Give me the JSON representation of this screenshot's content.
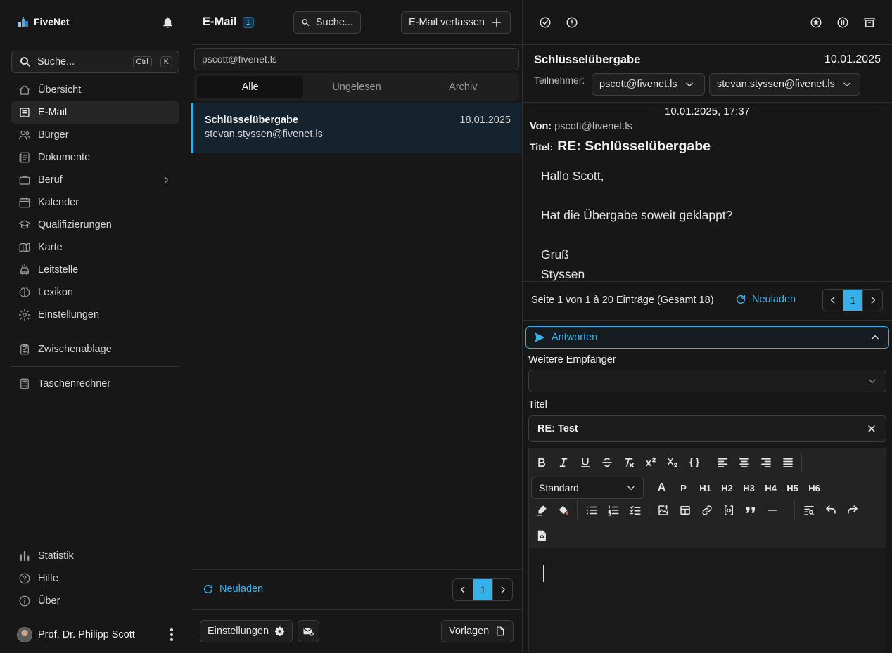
{
  "sidebar": {
    "brand": "FiveNet",
    "search_placeholder": "Suche...",
    "shortcut_ctrl": "Ctrl",
    "shortcut_key": "K",
    "items": [
      {
        "label": "Übersicht",
        "icon": "home-icon"
      },
      {
        "label": "E-Mail",
        "icon": "mail-icon"
      },
      {
        "label": "Bürger",
        "icon": "users-icon"
      },
      {
        "label": "Dokumente",
        "icon": "documents-icon"
      },
      {
        "label": "Beruf",
        "icon": "briefcase-icon"
      },
      {
        "label": "Kalender",
        "icon": "calendar-icon"
      },
      {
        "label": "Qualifizierungen",
        "icon": "graduation-cap-icon"
      },
      {
        "label": "Karte",
        "icon": "map-icon"
      },
      {
        "label": "Leitstelle",
        "icon": "car-siren-icon"
      },
      {
        "label": "Lexikon",
        "icon": "brain-icon"
      },
      {
        "label": "Einstellungen",
        "icon": "gear-icon"
      }
    ],
    "clipboard": "Zwischenablage",
    "calculator": "Taschenrechner",
    "bottom_items": [
      {
        "label": "Statistik",
        "icon": "bar-chart-icon"
      },
      {
        "label": "Hilfe",
        "icon": "help-icon"
      },
      {
        "label": "Über",
        "icon": "info-icon"
      }
    ],
    "user_name": "Prof. Dr. Philipp Scott"
  },
  "list": {
    "title": "E-Mail",
    "count": "1",
    "search_label": "Suche...",
    "compose_label": "E-Mail verfassen",
    "account": "pscott@fivenet.ls",
    "tabs": [
      "Alle",
      "Ungelesen",
      "Archiv"
    ],
    "active_tab": "Alle",
    "threads": [
      {
        "subject": "Schlüsselübergabe",
        "date": "18.01.2025",
        "from": "stevan.styssen@fivenet.ls"
      }
    ],
    "reload_label": "Neuladen",
    "page": "1",
    "settings_label": "Einstellungen",
    "templates_label": "Vorlagen"
  },
  "detail": {
    "subject": "Schlüsselübergabe",
    "date": "10.01.2025",
    "participants_label": "Teilnehmer:",
    "participants": [
      "pscott@fivenet.ls",
      "stevan.styssen@fivenet.ls"
    ],
    "message": {
      "datetime": "10.01.2025, 17:37",
      "from_label": "Von:",
      "from": "pscott@fivenet.ls",
      "title_label": "Titel:",
      "title": "RE: Schlüsselübergabe",
      "lines": [
        "Hallo Scott,",
        "Hat die Übergabe soweit geklappt?",
        "Gruß",
        "Styssen"
      ]
    },
    "pagination_text": "Seite 1 von 1 à 20 Einträge (Gesamt 18)",
    "reload_label": "Neuladen",
    "page": "1",
    "reply_label": "Antworten",
    "more_recipients_label": "Weitere Empfänger",
    "title_field_label": "Titel",
    "title_value": "RE: Test",
    "style_select": "Standard",
    "headings": [
      "A",
      "P",
      "H1",
      "H2",
      "H3",
      "H4",
      "H5",
      "H6"
    ]
  },
  "colors": {
    "accent": "#35b0e8",
    "background": "#171717"
  }
}
